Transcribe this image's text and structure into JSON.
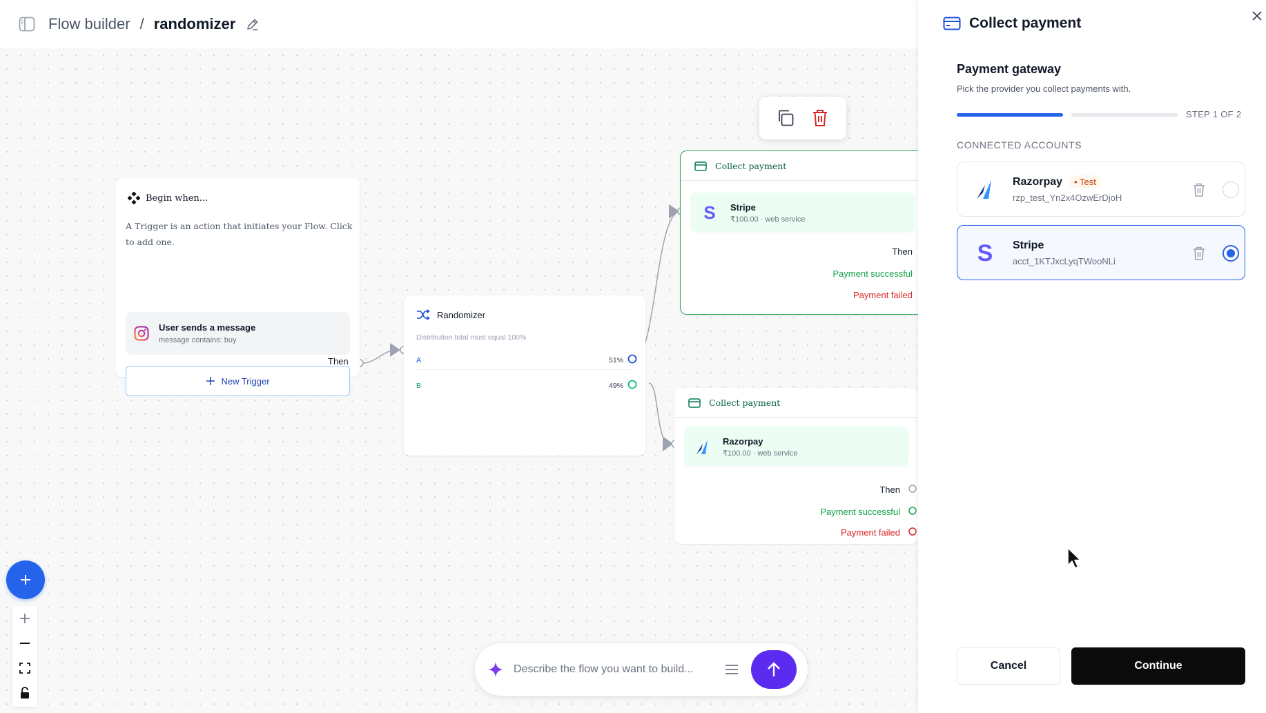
{
  "header": {
    "root": "Flow builder",
    "separator": "/",
    "flow_name": "randomizer"
  },
  "canvas": {
    "begin_node": {
      "title": "Begin when...",
      "description": "A Trigger is an action that initiates your Flow. Click to add one.",
      "trigger_title": "User sends a message",
      "trigger_sub": "message contains: buy",
      "new_trigger_label": "New Trigger",
      "then_label": "Then"
    },
    "randomizer_node": {
      "title": "Randomizer",
      "hint": "Distribution total must equal 100%",
      "branches": [
        {
          "label": "A",
          "percent": "51%"
        },
        {
          "label": "B",
          "percent": "49%"
        }
      ]
    },
    "pay_nodes": [
      {
        "title": "Collect payment",
        "provider": "Stripe",
        "detail": "₹100.00 · web service",
        "then": "Then",
        "success": "Payment successful",
        "failed": "Payment failed"
      },
      {
        "title": "Collect payment",
        "provider": "Razorpay",
        "detail": "₹100.00 · web service",
        "then": "Then",
        "success": "Payment successful",
        "failed": "Payment failed"
      }
    ],
    "prompt": {
      "placeholder": "Describe the flow you want to build..."
    }
  },
  "panel": {
    "title": "Collect payment",
    "section_title": "Payment gateway",
    "section_sub": "Pick the provider you collect payments with.",
    "step_label": "STEP 1 OF 2",
    "progress": {
      "current_step": 1,
      "total_steps": 2
    },
    "accounts_label": "CONNECTED ACCOUNTS",
    "accounts": [
      {
        "name": "Razorpay",
        "badge": "• Test",
        "id": "rzp_test_Yn2x4OzwErDjoH",
        "selected": false
      },
      {
        "name": "Stripe",
        "badge": "",
        "id": "acct_1KTJxcLyqTWooNLi",
        "selected": true
      }
    ],
    "cancel_label": "Cancel",
    "continue_label": "Continue"
  },
  "colors": {
    "accent": "#2563eb",
    "success": "#16a34a",
    "danger": "#dc2626",
    "stripe": "#635bff",
    "razorpay": "#0c2f8a",
    "send": "#5b2bef"
  }
}
